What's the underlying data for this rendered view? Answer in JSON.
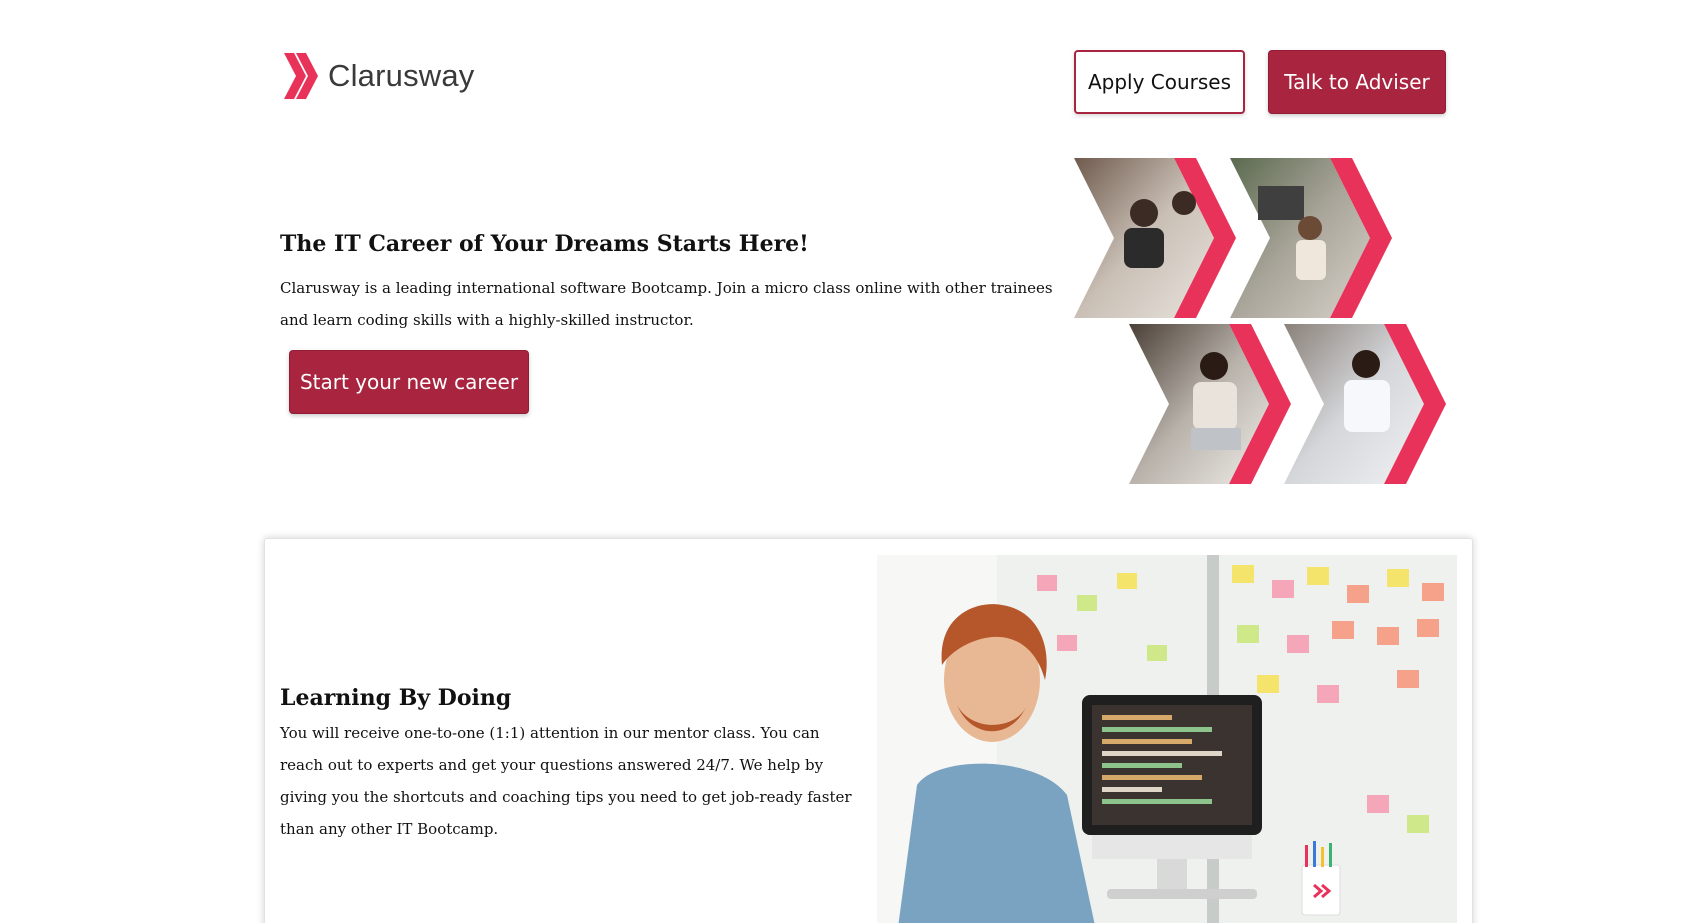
{
  "header": {
    "logo_text": "Clarusway",
    "apply_label": "Apply Courses",
    "adviser_label": "Talk to Adviser"
  },
  "hero": {
    "title": "The IT Career of Your Dreams Starts Here!",
    "description": "Clarusway is a leading international software Bootcamp. Join a micro class online with other trainees and learn coding skills with a highly-skilled instructor.",
    "cta_label": "Start your new career"
  },
  "learning": {
    "title": "Learning By Doing",
    "description": "You will receive one-to-one (1:1) attention in our mentor class. You can reach out to experts and get your questions answered 24/7. We help by giving you the shortcuts and coaching tips you need to get job-ready faster than any other IT Bootcamp."
  },
  "colors": {
    "brand": "#a8243f",
    "accent": "#e8325a"
  }
}
